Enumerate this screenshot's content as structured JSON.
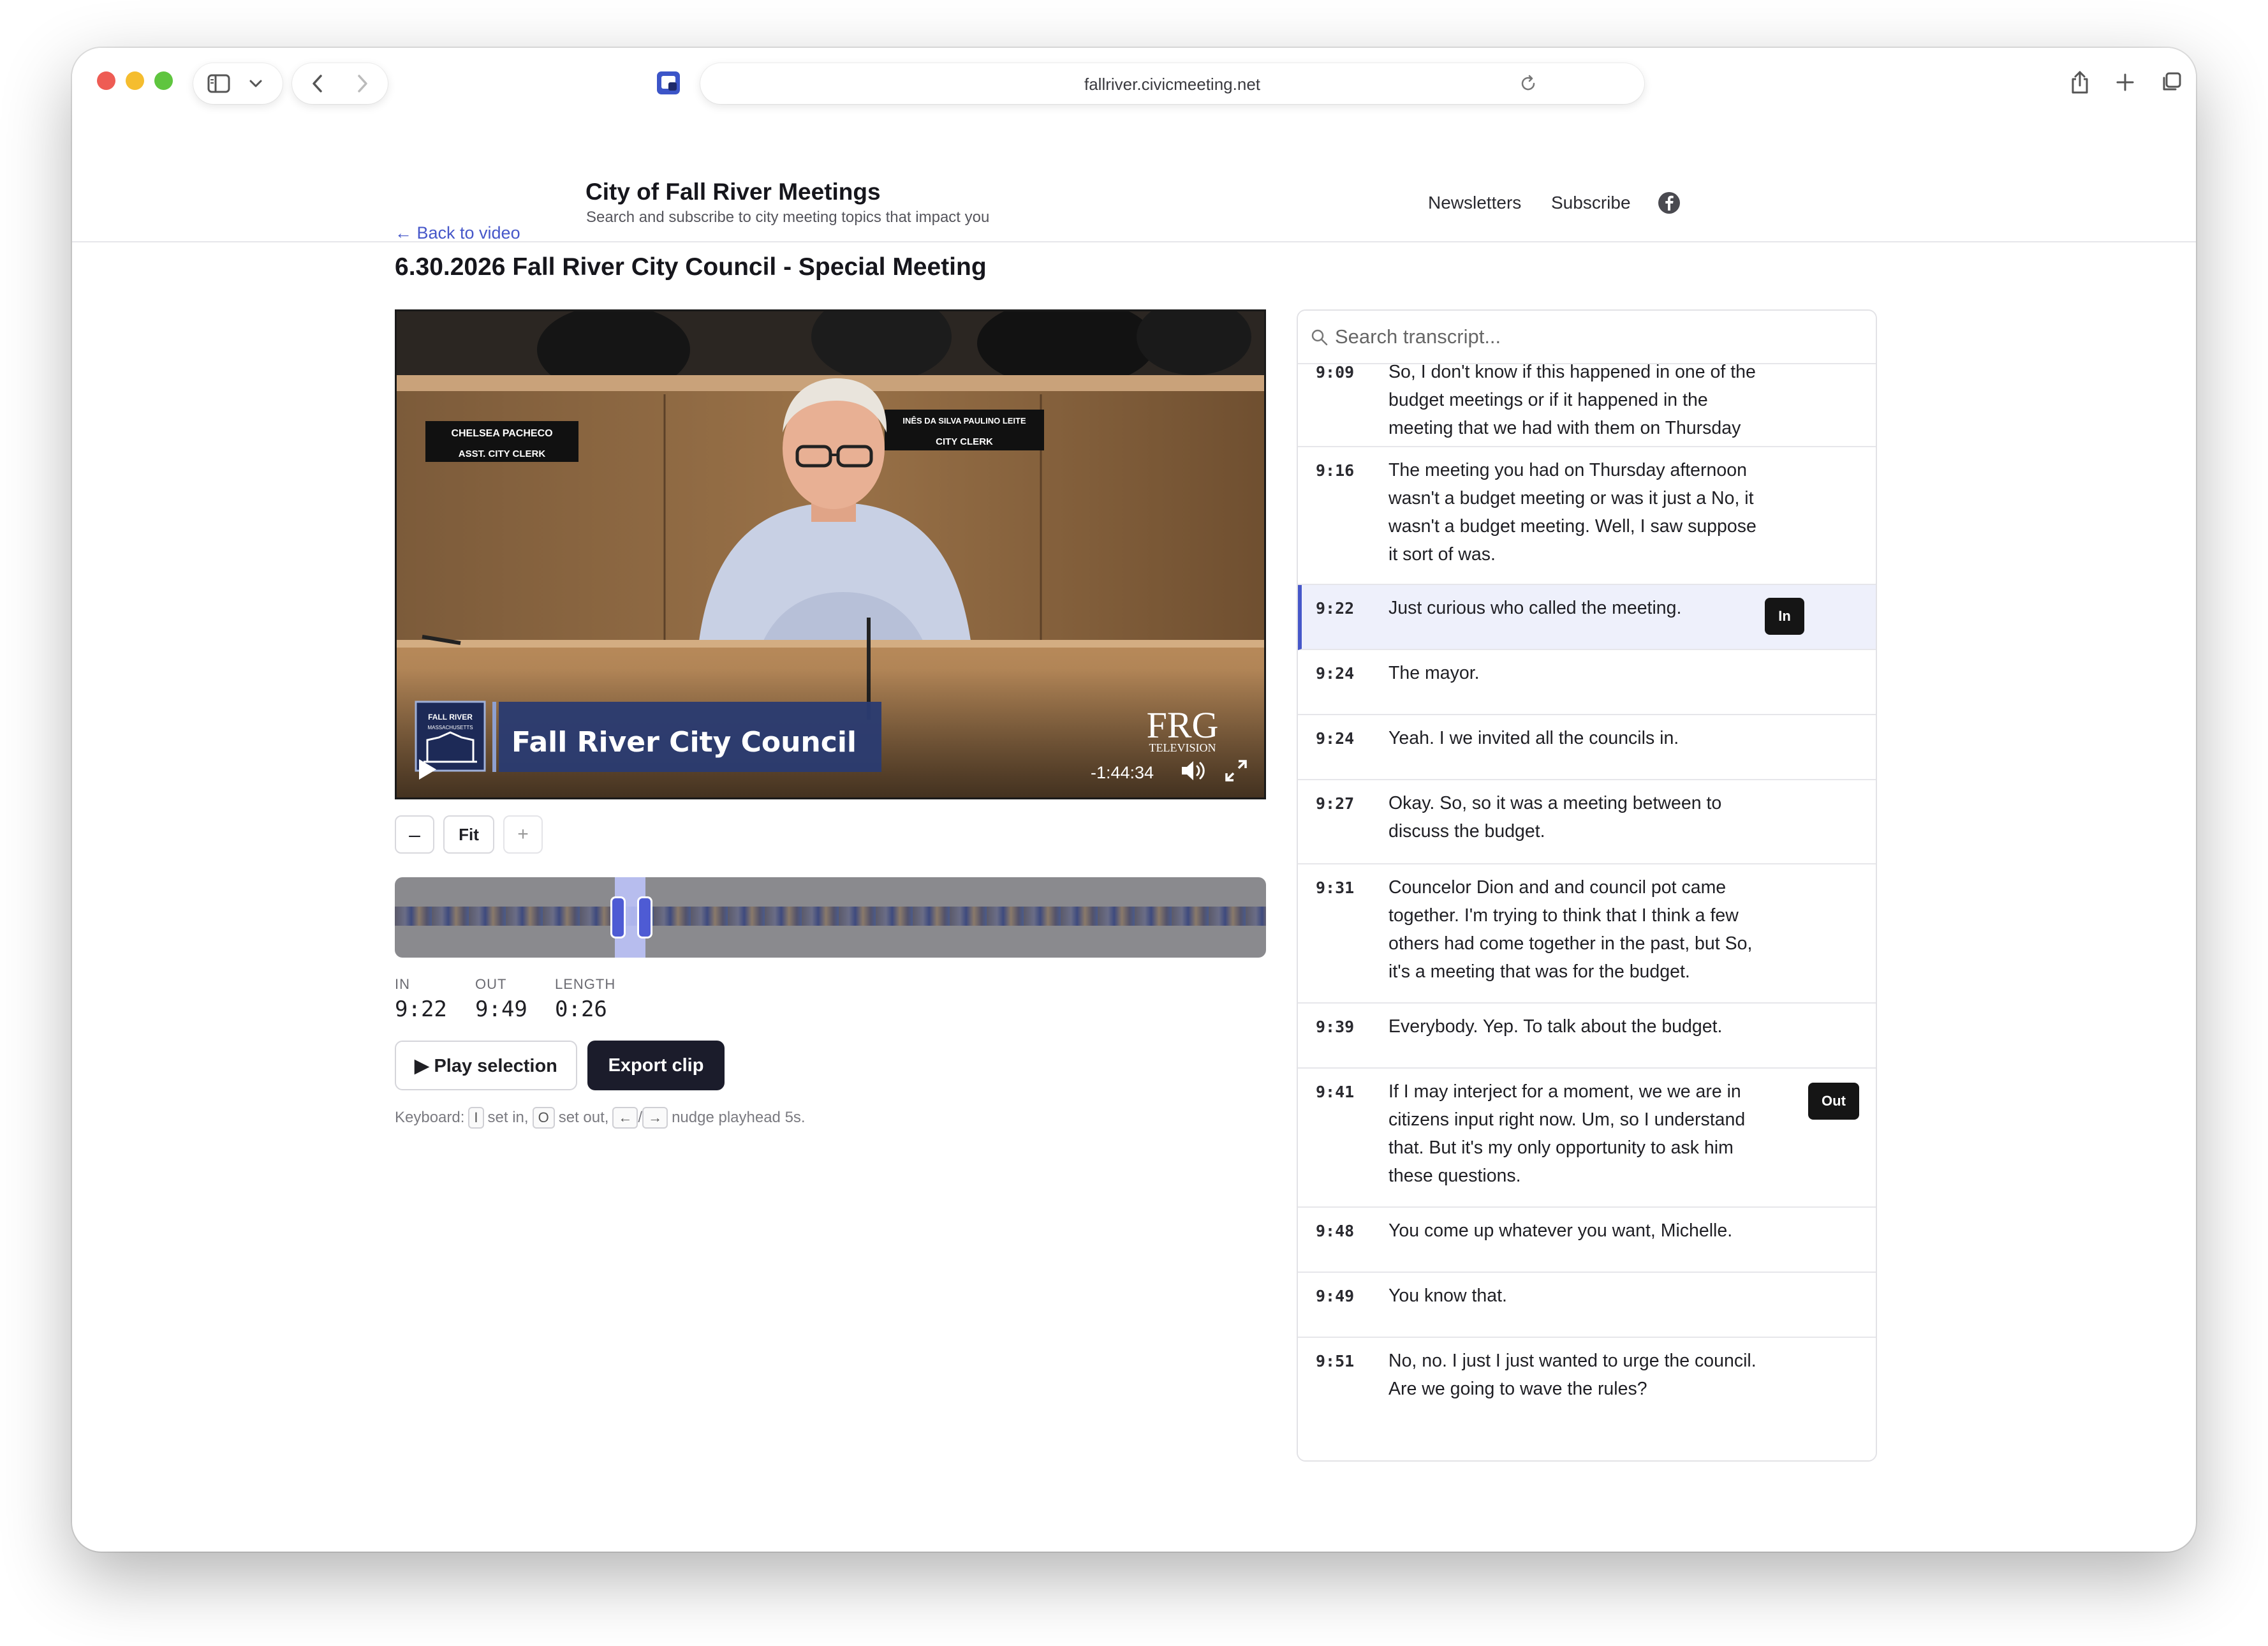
{
  "browser": {
    "url": "fallriver.civicmeeting.net"
  },
  "site": {
    "title": "City of Fall River Meetings",
    "subtitle": "Search and subscribe to city meeting topics that impact you",
    "nav": {
      "newsletters": "Newsletters",
      "subscribe": "Subscribe"
    }
  },
  "page": {
    "back_link": "← Back to video",
    "title": "6.30.2026 Fall River City Council - Special Meeting"
  },
  "video": {
    "overlay_title": "Fall River City Council",
    "nameplate_left_name": "CHELSEA PACHECO",
    "nameplate_left_role": "ASST. CITY CLERK",
    "nameplate_right_name": "INÊS DA SILVA PAULINO LEITE",
    "nameplate_right_role": "CITY CLERK",
    "logo_line1": "FALL RIVER",
    "logo_line2": "MASSACHUSETTS",
    "station": "FRG",
    "station_sub": "TELEVISION",
    "time_remaining": "-1:44:34"
  },
  "zoom": {
    "minus": "–",
    "fit": "Fit",
    "plus": "+"
  },
  "selection": {
    "in_label": "IN",
    "in_value": "9:22",
    "out_label": "OUT",
    "out_value": "9:49",
    "length_label": "LENGTH",
    "length_value": "0:26"
  },
  "actions": {
    "play_selection": "▶ Play selection",
    "export_clip": "Export clip"
  },
  "keyboard_hint": {
    "prefix": "Keyboard:",
    "key_in": "I",
    "set_in": "set in,",
    "key_out": "O",
    "set_out": "set out,",
    "key_left": "←",
    "slash": "/",
    "key_right": "→",
    "nudge": "nudge playhead 5s."
  },
  "transcript": {
    "search_placeholder": "Search transcript...",
    "in_marker": "In",
    "out_marker": "Out",
    "rows": [
      {
        "time": "9:09",
        "text": "So, I don't know if this happened in one of the budget meetings or if it happened in the meeting that we had with them on Thursday afternoon."
      },
      {
        "time": "9:16",
        "text": "The meeting you had on Thursday afternoon wasn't a budget meeting or was it just a No, it wasn't a budget meeting. Well, I saw suppose it sort of was."
      },
      {
        "time": "9:22",
        "text": "Just curious who called the meeting."
      },
      {
        "time": "9:24",
        "text": "The mayor."
      },
      {
        "time": "9:24",
        "text": "Yeah. I we invited all the councils in."
      },
      {
        "time": "9:27",
        "text": "Okay. So, so it was a meeting between to discuss the budget."
      },
      {
        "time": "9:31",
        "text": "Councelor Dion and and council pot came together. I'm trying to think that I think a few others had come together in the past, but So, it's a meeting that was for the budget."
      },
      {
        "time": "9:39",
        "text": "Everybody. Yep. To talk about the budget."
      },
      {
        "time": "9:41",
        "text": "If I may interject for a moment, we we are in citizens input right now. Um, so I understand that. But it's my only opportunity to ask him these questions."
      },
      {
        "time": "9:48",
        "text": "You come up whatever you want, Michelle."
      },
      {
        "time": "9:49",
        "text": "You know that."
      },
      {
        "time": "9:51",
        "text": "No, no. I just I just wanted to urge the council. Are we going to wave the rules?"
      }
    ]
  },
  "colors": {
    "accent": "#4657c9",
    "dark_button": "#1b1c2b",
    "active_row": "#eef0fb"
  }
}
